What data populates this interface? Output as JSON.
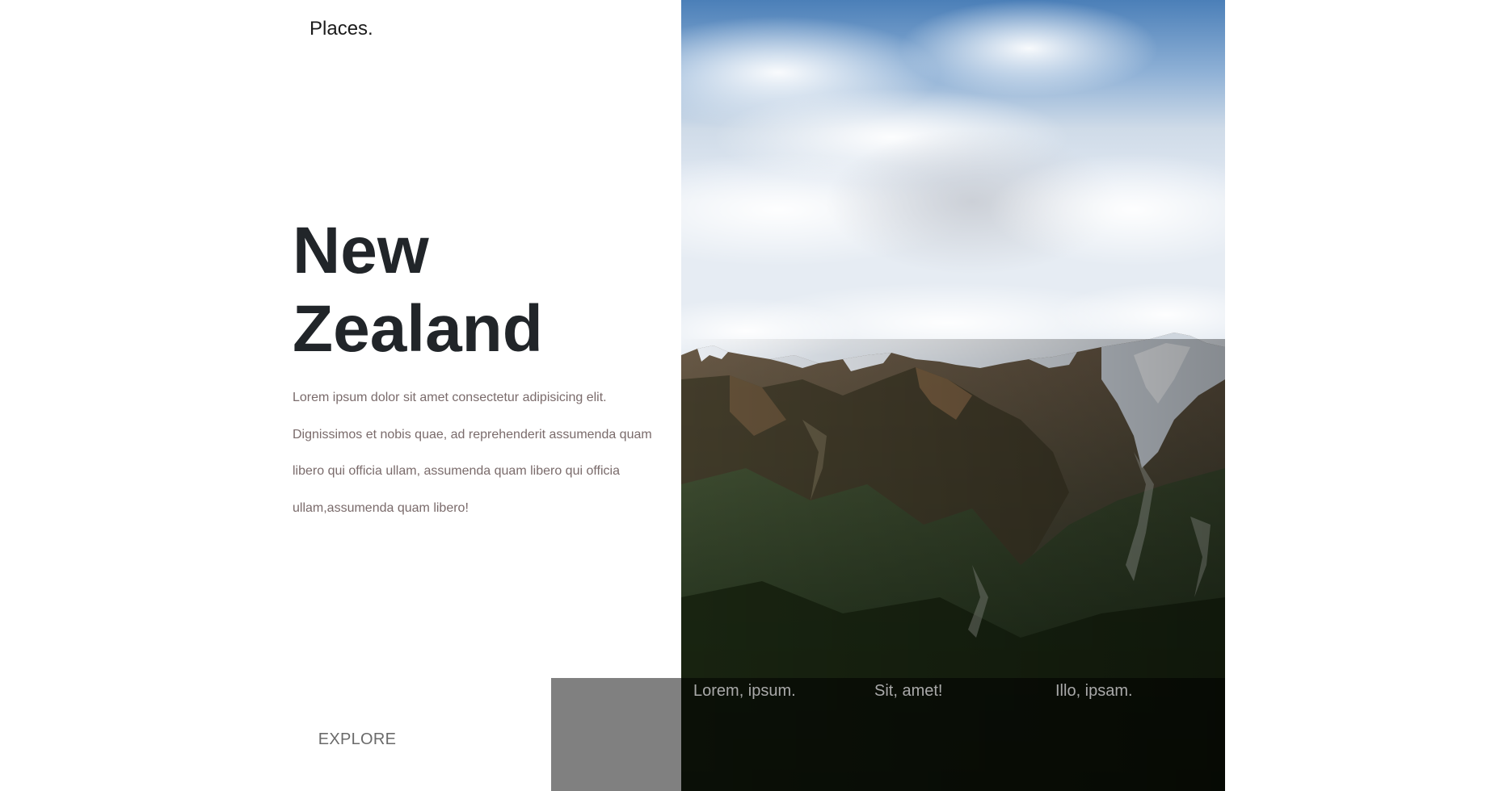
{
  "header": {
    "logo": "Places."
  },
  "hero": {
    "title_line1": "New",
    "title_line2": "Zealand",
    "description": "Lorem ipsum dolor sit amet consectetur adipisicing elit. Dignissimos et nobis quae, ad reprehenderit assumenda quam libero qui officia ullam, assumenda quam libero qui officia ullam,assumenda quam libero!",
    "explore_label": "EXPLORE"
  },
  "image": {
    "subject": "mountain-landscape-photo"
  },
  "bottom_bar": {
    "links": [
      {
        "label": "Lorem, ipsum."
      },
      {
        "label": "Sit, amet!"
      },
      {
        "label": "Illo, ipsam."
      }
    ]
  },
  "colors": {
    "title": "#212529",
    "text": "#7a6b6b",
    "gray_block": "#808080",
    "bar_link": "#a9a9a9"
  }
}
